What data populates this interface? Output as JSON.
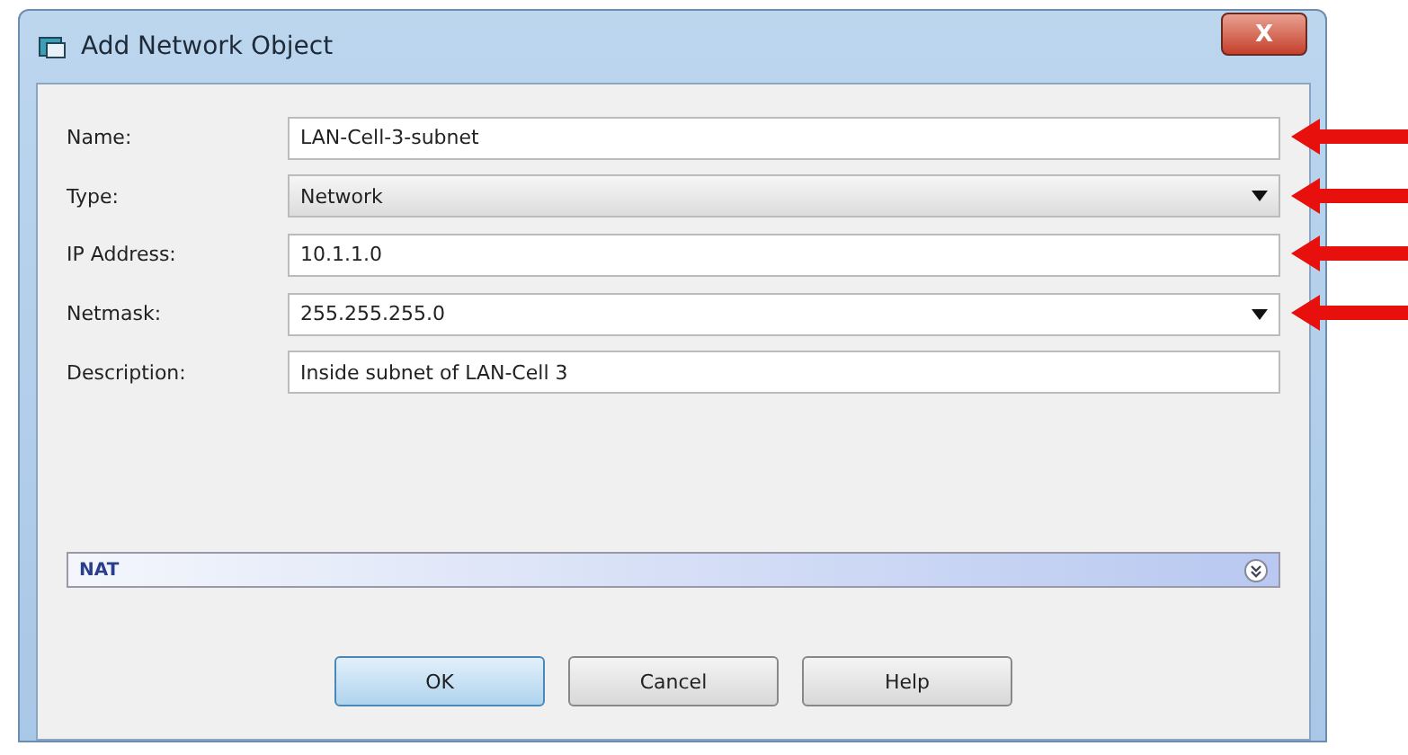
{
  "window": {
    "title": "Add Network Object",
    "close": "X"
  },
  "fields": [
    {
      "label": "Name:",
      "kind": "text",
      "value": "LAN-Cell-3-subnet",
      "marked": true
    },
    {
      "label": "Type:",
      "kind": "dropdown",
      "value": "Network",
      "marked": true
    },
    {
      "label": "IP Address:",
      "kind": "text",
      "value": "10.1.1.0",
      "marked": true
    },
    {
      "label": "Netmask:",
      "kind": "combo",
      "value": "255.255.255.0",
      "marked": true
    },
    {
      "label": "Description:",
      "kind": "text",
      "value": "Inside subnet of LAN-Cell 3",
      "marked": false
    }
  ],
  "section": {
    "title": "NAT",
    "expanded": false
  },
  "buttons": [
    {
      "label": "OK",
      "default": true
    },
    {
      "label": "Cancel",
      "default": false
    },
    {
      "label": "Help",
      "default": false
    }
  ]
}
